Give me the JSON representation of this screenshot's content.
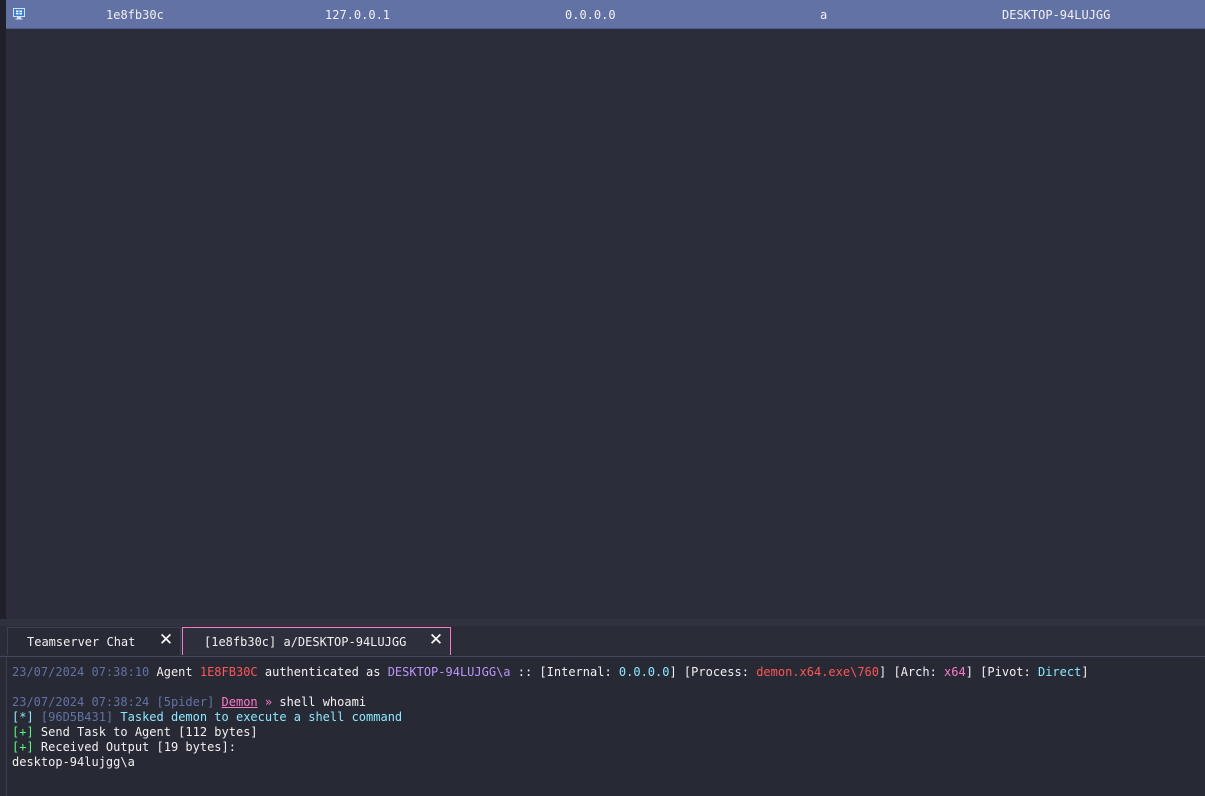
{
  "sessions_table": {
    "rows": [
      {
        "os_icon": "windows-monitor-icon",
        "id": "1e8fb30c",
        "external": "127.0.0.1",
        "internal": "0.0.0.0",
        "user": "a",
        "computer": "DESKTOP-94LUJGG"
      }
    ]
  },
  "tabs": [
    {
      "label": "Teamserver Chat",
      "close": "✕"
    },
    {
      "label": "[1e8fb30c] a/DESKTOP-94LUJGG",
      "close": "✕"
    }
  ],
  "console": {
    "line1": {
      "timestamp": "23/07/2024 07:38:10",
      "agent_word": " Agent ",
      "agent_id": "1E8FB30C",
      "auth_text": " authenticated as ",
      "identity": "DESKTOP-94LUJGG\\a",
      "sep": " :: [Internal: ",
      "internal": "0.0.0.0",
      "proc_label": "] [Process: ",
      "process": "demon.x64.exe\\760",
      "arch_label": "] [Arch: ",
      "arch": "x64",
      "pivot_label": "] [Pivot: ",
      "pivot": "Direct",
      "end": "]"
    },
    "line2": {
      "timestamp": "23/07/2024 07:38:24",
      "operator": " [5pider] ",
      "agent": "Demon",
      "prompt": " » ",
      "command": "shell whoami"
    },
    "line3": {
      "tag": "[*]",
      "task_id": " [96D5B431] ",
      "text": "Tasked demon to execute a shell command"
    },
    "line4": {
      "tag": "[+]",
      "text": " Send Task to Agent [112 bytes]"
    },
    "line5": {
      "tag": "[+]",
      "text": " Received Output [19 bytes]:"
    },
    "line6": {
      "text": "desktop-94lujgg\\a"
    }
  },
  "colors": {
    "selected_row": "#6272a4",
    "background": "#282a36",
    "accent_pink": "#ff79c6",
    "red": "#ff5555",
    "purple": "#bd93f9",
    "cyan": "#8be9fd",
    "green": "#50fa7b"
  }
}
